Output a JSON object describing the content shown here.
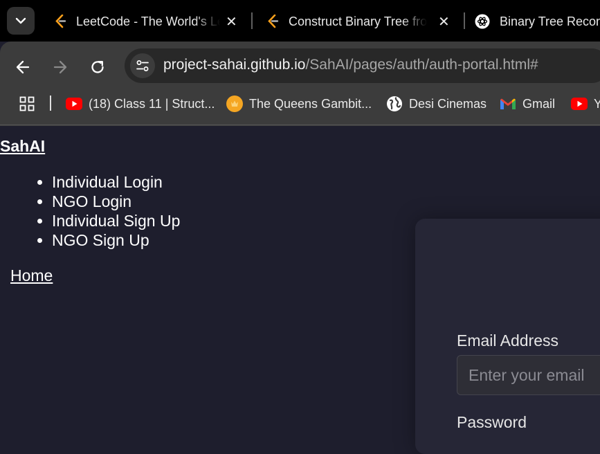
{
  "browser": {
    "tabs": [
      {
        "title": "LeetCode - The World's Leading Online Programming Learning Platform",
        "icon": "leetcode-icon"
      },
      {
        "title": "Construct Binary Tree from Preorder and Inorder Traversal",
        "icon": "leetcode-icon"
      },
      {
        "title": "Binary Tree Reconstruction",
        "icon": "chatgpt-icon"
      }
    ],
    "close_glyph": "✕",
    "url_host": "project-sahai.github.io",
    "url_path": "/SahAI/pages/auth/auth-portal.html#",
    "bookmarks": [
      {
        "label": "(18) Class 11 | Struct...",
        "icon": "youtube-icon"
      },
      {
        "label": "The Queens Gambit...",
        "icon": "queens-gambit-icon"
      },
      {
        "label": "Desi Cinemas",
        "icon": "globe-icon"
      },
      {
        "label": "Gmail",
        "icon": "gmail-icon"
      },
      {
        "label": "Y",
        "icon": "youtube-icon"
      }
    ]
  },
  "page": {
    "brand": "SahAI",
    "nav_items": [
      "Individual Login",
      "NGO Login",
      "Individual Sign Up",
      "NGO Sign Up"
    ],
    "home_link": "Home",
    "form": {
      "email_label": "Email Address",
      "email_placeholder": "Enter your email",
      "password_label": "Password"
    }
  },
  "colors": {
    "tab_strip": "#000000",
    "toolbar": "#3c3c3c",
    "page_background": "#1e1e2d",
    "card_background": "#262636"
  }
}
